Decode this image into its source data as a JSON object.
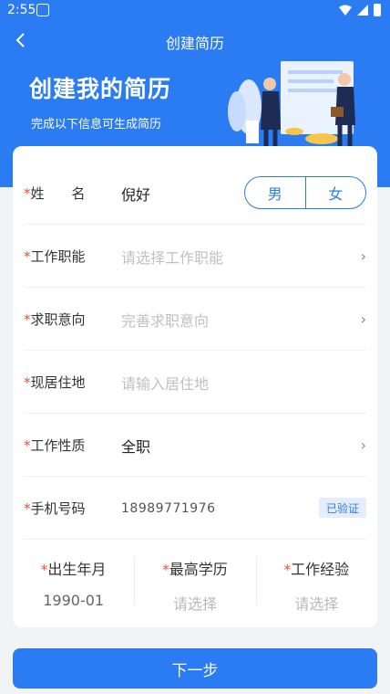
{
  "status_bar": {
    "time": "2:55"
  },
  "nav": {
    "title": "创建简历"
  },
  "hero": {
    "title": "创建我的简历",
    "subtitle": "完成以下信息可生成简历"
  },
  "form": {
    "name": {
      "label": "姓　　名",
      "value": "倪好",
      "required": "*"
    },
    "gender": {
      "male": "男",
      "female": "女"
    },
    "job_function": {
      "label": "工作职能",
      "placeholder": "请选择工作职能",
      "required": "*"
    },
    "job_intention": {
      "label": "求职意向",
      "placeholder": "完善求职意向",
      "required": "*"
    },
    "residence": {
      "label": "现居住地",
      "placeholder": "请输入居住地",
      "required": "*"
    },
    "job_type": {
      "label": "工作性质",
      "value": "全职",
      "required": "*"
    },
    "phone": {
      "label": "手机号码",
      "value": "18989771976",
      "badge": "已验证",
      "required": "*"
    },
    "birth": {
      "label": "出生年月",
      "value": "1990-01",
      "required": "*"
    },
    "education": {
      "label": "最高学历",
      "placeholder": "请选择",
      "required": "*"
    },
    "experience": {
      "label": "工作经验",
      "placeholder": "请选择",
      "required": "*"
    }
  },
  "footer": {
    "next_label": "下一步"
  },
  "colors": {
    "primary": "#2b7bf3",
    "required": "#f04b3a"
  }
}
